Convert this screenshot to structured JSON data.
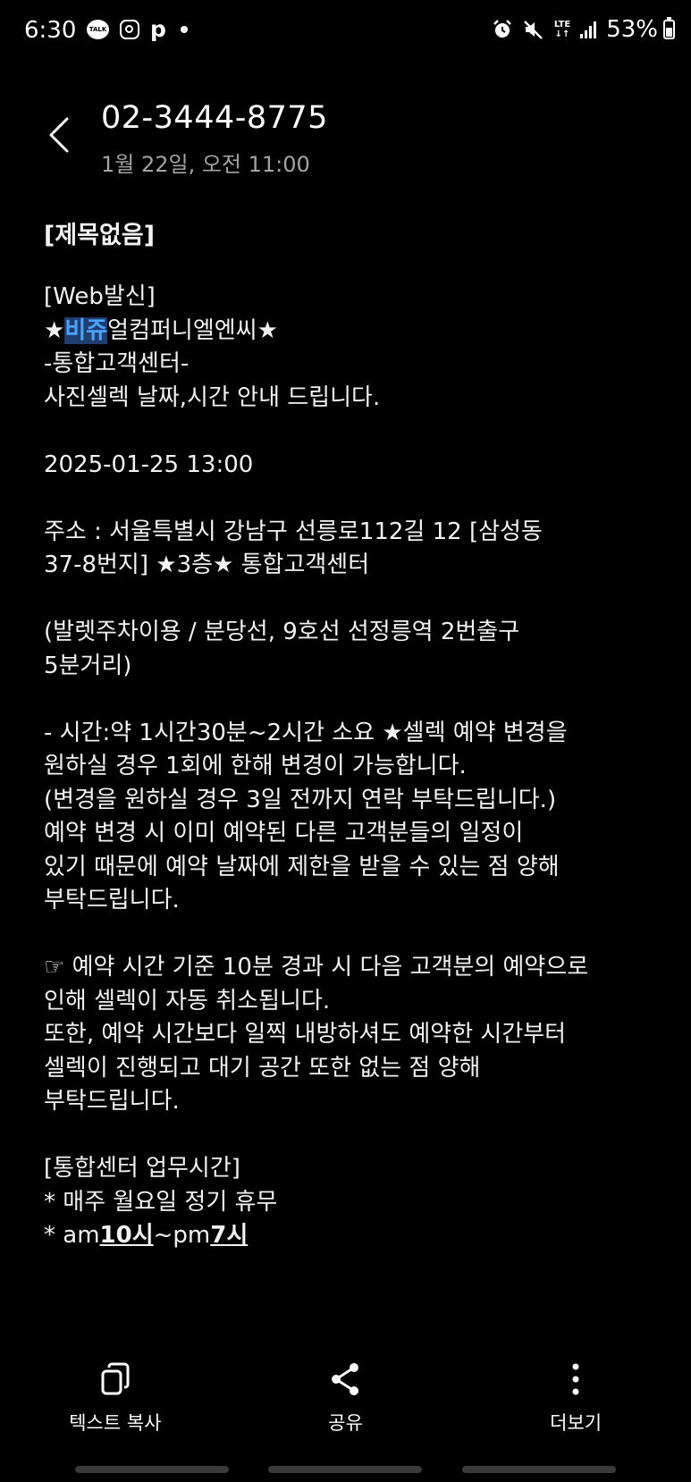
{
  "status_bar": {
    "time": "6:30",
    "left_icons": [
      "talk-icon",
      "instagram-icon",
      "p-icon",
      "dot-icon"
    ],
    "right_icons": [
      "alarm-icon",
      "mute-icon",
      "lte-icon",
      "signal-icon",
      "battery-icon"
    ],
    "lte_label": "LTE",
    "battery": "53%"
  },
  "header": {
    "sender": "02-3444-8775",
    "date": "1월 22일, 오전 11:00"
  },
  "message": {
    "subject": "[제목없음]",
    "l01": "[Web발신]",
    "l02_pre": "★",
    "l02_sel": "비쥬",
    "l02_post": "얼컴퍼니엘엔씨★",
    "l03": "-통합고객센터-",
    "l04": "사진셀렉 날짜,시간 안내 드립니다.",
    "l05": "2025-01-25 13:00",
    "l06": "주소 : 서울특별시 강남구 선릉로112길 12 [삼성동",
    "l07": "37-8번지] ★3층★ 통합고객센터",
    "l08": "(발렛주차이용 / 분당선, 9호선 선정릉역 2번출구",
    "l09": "5분거리)",
    "l10": "- 시간:약 1시간30분~2시간 소요 ★셀렉 예약 변경을",
    "l11": "원하실 경우 1회에 한해 변경이 가능합니다.",
    "l12": "(변경을 원하실 경우 3일 전까지 연락 부탁드립니다.)",
    "l13": "예약 변경 시 이미 예약된 다른 고객분들의 일정이",
    "l14": "있기 때문에 예약 날짜에 제한을 받을 수 있는 점 양해",
    "l15": "부탁드립니다.",
    "l16": "☞ 예약 시간 기준 10분 경과 시 다음 고객분의 예약으로",
    "l17": "인해 셀렉이 자동 취소됩니다.",
    "l18": "또한, 예약 시간보다 일찍 내방하셔도 예약한 시간부터",
    "l19": "셀렉이 진행되고 대기 공간 또한 없는 점 양해",
    "l20": "부탁드립니다.",
    "l21": "[통합센터 업무시간]",
    "l22": "* 매주 월요일 정기 휴무",
    "l23_a": "* am",
    "l23_b": "10시",
    "l23_c": "~pm",
    "l23_d": "7시"
  },
  "bottom_bar": {
    "copy_text": "텍스트 복사",
    "share": "공유",
    "more": "더보기"
  },
  "colors": {
    "background": "#000000",
    "text": "#f2f2f2",
    "secondary_text": "#a3a3a3",
    "selection_text": "#4aa3ff",
    "selection_bg": "#1f3d6e"
  }
}
